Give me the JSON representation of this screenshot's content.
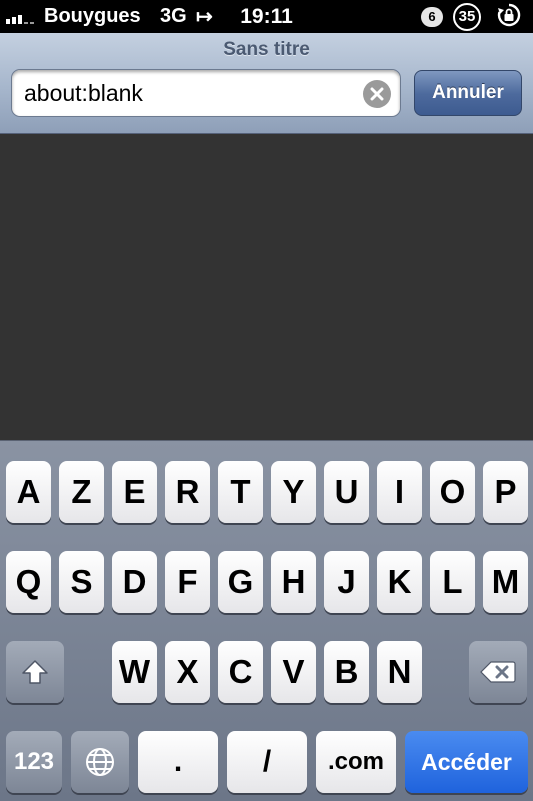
{
  "status_bar": {
    "carrier": "Bouygues",
    "network": "3G",
    "transfer_icon": "call-forward-icon",
    "time": "19:11",
    "badge_small": "6",
    "badge_large": "35",
    "rotation_lock_icon": "rotation-lock-icon"
  },
  "browser": {
    "title": "Sans titre",
    "url_value": "about:blank",
    "cancel_label": "Annuler",
    "clear_icon": "clear-x-icon"
  },
  "keyboard": {
    "row1": [
      "A",
      "Z",
      "E",
      "R",
      "T",
      "Y",
      "U",
      "I",
      "O",
      "P"
    ],
    "row2": [
      "Q",
      "S",
      "D",
      "F",
      "G",
      "H",
      "J",
      "K",
      "L",
      "M"
    ],
    "row3": [
      "W",
      "X",
      "C",
      "V",
      "B",
      "N"
    ],
    "shift_icon": "shift-arrow-icon",
    "delete_icon": "backspace-icon",
    "numbers_label": "123",
    "globe_icon": "globe-icon",
    "dot_label": ".",
    "slash_label": "/",
    "com_label": ".com",
    "go_label": "Accéder",
    "colors": {
      "go_key": "#1f63dd",
      "accent_bar": "#4d6a9d"
    }
  }
}
